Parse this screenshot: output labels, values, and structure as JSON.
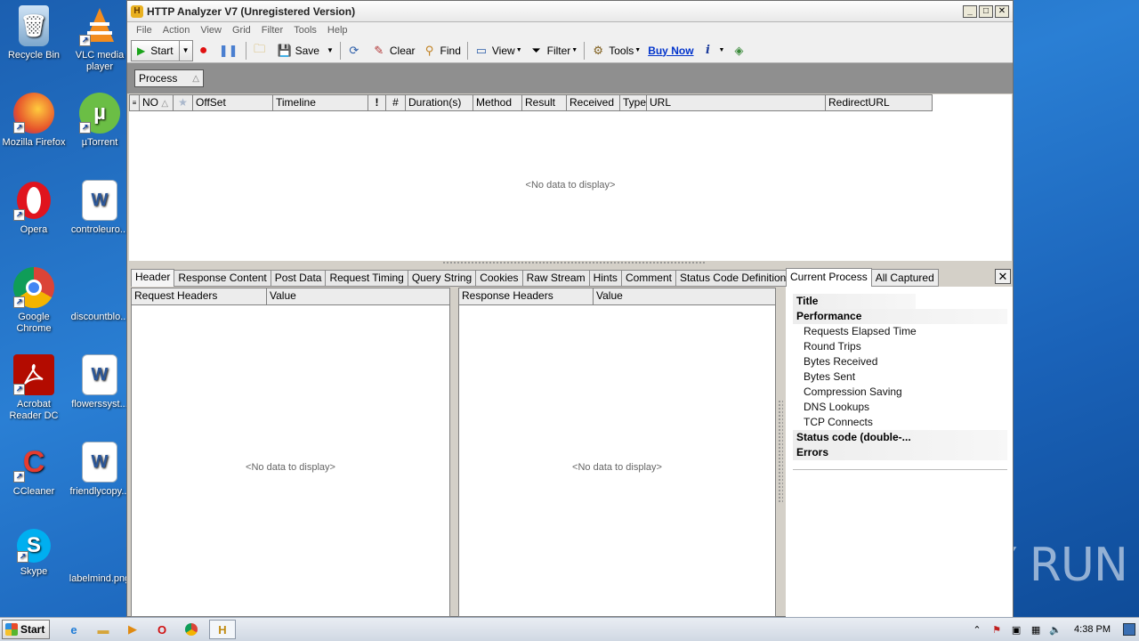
{
  "desktop": {
    "icons": [
      {
        "label": "Recycle Bin"
      },
      {
        "label": "VLC media player"
      },
      {
        "label": "Mozilla Firefox"
      },
      {
        "label": "µTorrent"
      },
      {
        "label": "Opera"
      },
      {
        "label": "controleuro..."
      },
      {
        "label": "Google Chrome"
      },
      {
        "label": "discountblo..."
      },
      {
        "label": "Acrobat Reader DC"
      },
      {
        "label": "flowerssyst..."
      },
      {
        "label": "CCleaner"
      },
      {
        "label": "friendlycopy..."
      },
      {
        "label": "Skype"
      },
      {
        "label": "labelmind.png"
      }
    ],
    "watermark": "ANY RUN"
  },
  "window": {
    "title": "HTTP Analyzer V7  (Unregistered Version)",
    "controls": {
      "minimize": "_",
      "maximize": "□",
      "close": "✕"
    },
    "menu": [
      "File",
      "Action",
      "View",
      "Grid",
      "Filter",
      "Tools",
      "Help"
    ],
    "toolbar": {
      "start": "Start",
      "save": "Save",
      "clear": "Clear",
      "find": "Find",
      "view": "View",
      "filter": "Filter",
      "tools": "Tools",
      "buy_now": "Buy Now"
    },
    "group_chip": "Process",
    "grid_columns": [
      "NO",
      "OffSet",
      "Timeline",
      "!",
      "#",
      "Duration(s)",
      "Method",
      "Result",
      "Received",
      "Type",
      "URL",
      "RedirectURL"
    ],
    "grid_empty": "<No data to display>",
    "detail_tabs": [
      "Header",
      "Response Content",
      "Post Data",
      "Request Timing",
      "Query String",
      "Cookies",
      "Raw Stream",
      "Hints",
      "Comment",
      "Status Code Definition"
    ],
    "request_panel": {
      "col1": "Request Headers",
      "col2": "Value",
      "empty": "<No data to display>"
    },
    "response_panel": {
      "col1": "Response Headers",
      "col2": "Value",
      "empty": "<No data to display>"
    },
    "right_tabs": [
      "Current Process",
      "All Captured"
    ],
    "right_close": "✕",
    "tree": {
      "title": "Title",
      "performance": "Performance",
      "items": [
        "Requests Elapsed Time",
        "Round Trips",
        "Bytes Received",
        "Bytes Sent",
        "Compression Saving",
        "DNS Lookups",
        "TCP Connects"
      ],
      "status_code": "Status code (double-...",
      "errors": "Errors"
    }
  },
  "taskbar": {
    "start": "Start",
    "clock": "4:38 PM"
  }
}
